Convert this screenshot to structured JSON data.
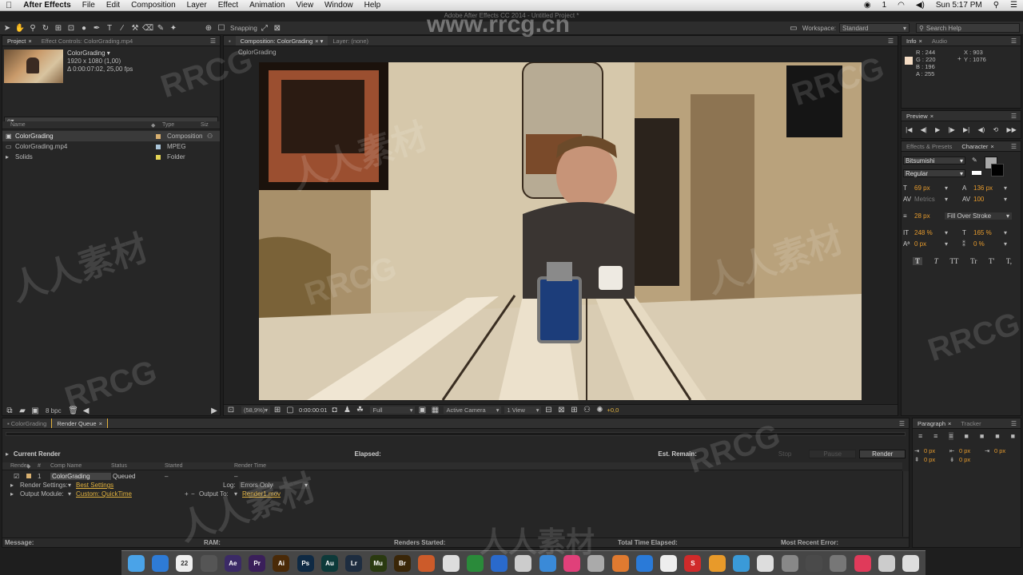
{
  "mac_menu": {
    "app": "After Effects",
    "items": [
      "File",
      "Edit",
      "Composition",
      "Layer",
      "Effect",
      "Animation",
      "View",
      "Window",
      "Help"
    ],
    "battery": "1",
    "clock": "Sun 5:17 PM"
  },
  "window_title": "Adobe After Effects CC 2014 - Untitled Project *",
  "toolbar": {
    "snapping": "Snapping",
    "workspace_label": "Workspace:",
    "workspace_value": "Standard",
    "search_placeholder": "Search Help"
  },
  "project": {
    "tab_project": "Project",
    "tab_effect_controls": "Effect Controls: ColorGrading.mp4",
    "thumb_name": "ColorGrading ▾",
    "thumb_res": "1920 x 1080 (1,00)",
    "thumb_dur": "Δ 0:00:07:02, 25,00 fps",
    "search_placeholder": "ρ▾",
    "col_name": "Name",
    "col_type": "Type",
    "col_size": "Siz",
    "items": [
      {
        "name": "ColorGrading",
        "type": "Composition",
        "color": "#d8b070"
      },
      {
        "name": "ColorGrading.mp4",
        "type": "MPEG",
        "color": "#a9c4d8"
      },
      {
        "name": "Solids",
        "type": "Folder",
        "color": "#e4d455"
      }
    ],
    "bpc": "8 bpc"
  },
  "comp": {
    "tab_comp": "Composition: ColorGrading",
    "tab_layer": "Layer: (none)",
    "breadcrumb": "ColorGrading",
    "zoom": "(58,9%)",
    "timecode": "0:00:00:01",
    "resolution": "Full",
    "camera": "Active Camera",
    "views": "1 View",
    "exposure": "+0,0"
  },
  "info": {
    "tab_info": "Info",
    "tab_audio": "Audio",
    "r": "R : 244",
    "g": "G : 220",
    "b": "B : 196",
    "a": "A : 255",
    "x": "X : 903",
    "y": "Y : 1076",
    "swatch": "#f4dcc4"
  },
  "preview": {
    "tab": "Preview"
  },
  "character": {
    "tab_effects": "Effects & Presets",
    "tab_character": "Character",
    "font": "Bitsumishi",
    "style": "Regular",
    "size": "69 px",
    "leading": "136 px",
    "kerning": "Metrics",
    "tracking": "100",
    "stroke": "28 px",
    "stroke_type": "Fill Over Stroke",
    "vscale": "248 %",
    "hscale": "165 %",
    "baseline": "0 px",
    "tsume": "0 %",
    "styles": [
      "T",
      "T",
      "TT",
      "Tr",
      "T'",
      "T,"
    ]
  },
  "paragraph": {
    "tab_paragraph": "Paragraph",
    "tab_tracker": "Tracker",
    "indent_left": "0 px",
    "indent_first": "0 px",
    "indent_right": "0 px",
    "space_before": "0 px",
    "space_after": "0 px"
  },
  "render_queue": {
    "tab_comp": "ColorGrading",
    "tab_rq": "Render Queue",
    "current_render": "Current Render",
    "elapsed": "Elapsed:",
    "est_remain": "Est. Remain:",
    "btn_stop": "Stop",
    "btn_pause": "Pause",
    "btn_render": "Render",
    "cols": [
      "Render",
      "#",
      "Comp Name",
      "Status",
      "Started",
      "Render Time"
    ],
    "item_num": "1",
    "item_comp": "ColorGrading",
    "item_status": "Queued",
    "item_started": "–",
    "item_time": "–",
    "render_settings_label": "Render Settings:",
    "render_settings_value": "Best Settings",
    "log_label": "Log:",
    "log_value": "Errors Only",
    "output_module_label": "Output Module:",
    "output_module_value": "Custom: QuickTime",
    "output_to_label": "Output To:",
    "output_to_value": "Render1.mov",
    "status_message": "Message:",
    "status_ram": "RAM:",
    "status_started": "Renders Started:",
    "status_total": "Total Time Elapsed:",
    "status_error": "Most Recent Error:"
  },
  "dock": [
    {
      "label": "",
      "color": "#4aa3e8"
    },
    {
      "label": "",
      "color": "#2e7bd6"
    },
    {
      "label": "22",
      "color": "#eee"
    },
    {
      "label": "",
      "color": "#555"
    },
    {
      "label": "Ae",
      "color": "#3b2a66"
    },
    {
      "label": "Pr",
      "color": "#3a1f5a"
    },
    {
      "label": "Ai",
      "color": "#4a2a08"
    },
    {
      "label": "Ps",
      "color": "#0f2a44"
    },
    {
      "label": "Au",
      "color": "#0d3a3a"
    },
    {
      "label": "Lr",
      "color": "#1e2d40"
    },
    {
      "label": "Mu",
      "color": "#2a3a10"
    },
    {
      "label": "Br",
      "color": "#3a2608"
    },
    {
      "label": "",
      "color": "#cc5b2a"
    },
    {
      "label": "",
      "color": "#ddd"
    },
    {
      "label": "",
      "color": "#2a8a3a"
    },
    {
      "label": "",
      "color": "#2a6acc"
    },
    {
      "label": "",
      "color": "#ccc"
    },
    {
      "label": "",
      "color": "#3a8ad8"
    },
    {
      "label": "",
      "color": "#e0407a"
    },
    {
      "label": "",
      "color": "#aaa"
    },
    {
      "label": "",
      "color": "#e07a30"
    },
    {
      "label": "",
      "color": "#2a7ad8"
    },
    {
      "label": "",
      "color": "#eee"
    },
    {
      "label": "S",
      "color": "#d02a2a"
    },
    {
      "label": "",
      "color": "#e89a2a"
    },
    {
      "label": "",
      "color": "#3a9ad8"
    },
    {
      "label": "",
      "color": "#ddd"
    },
    {
      "label": "",
      "color": "#888"
    },
    {
      "label": "",
      "color": "#4a4a4a"
    },
    {
      "label": "",
      "color": "#777"
    },
    {
      "label": "",
      "color": "#e03a5a"
    },
    {
      "label": "",
      "color": "#ccc"
    },
    {
      "label": "",
      "color": "#ddd"
    }
  ],
  "watermarks": {
    "url": "www.rrcg.cn",
    "brand": "RRCG",
    "cn": "人人素材"
  }
}
